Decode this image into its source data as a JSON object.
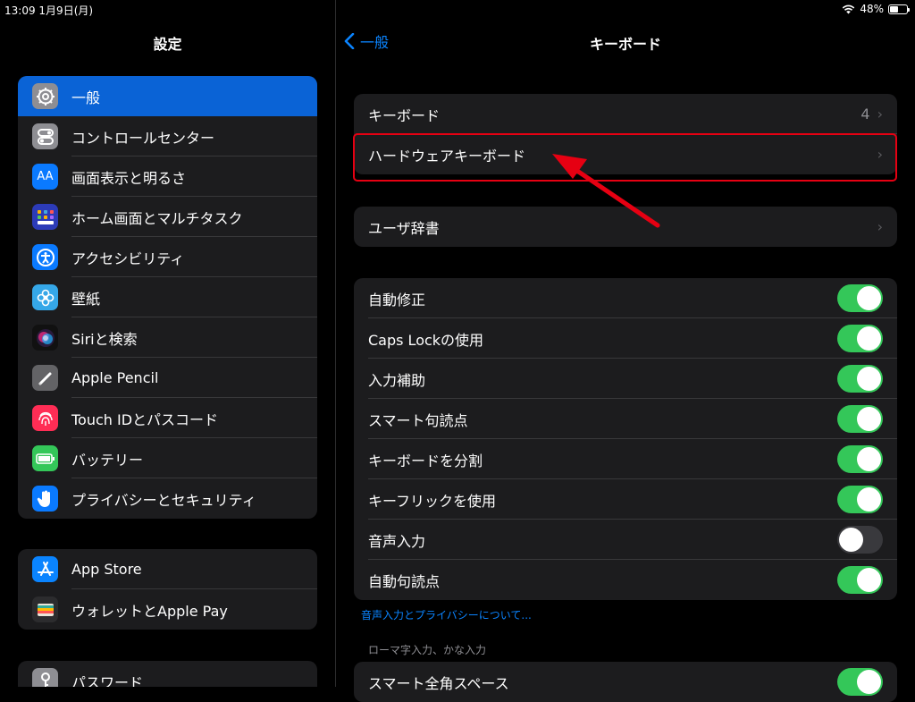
{
  "status_bar": {
    "time": "13:09",
    "date": "1月9日(月)",
    "battery": "48%",
    "battery_level": 0.48
  },
  "sidebar": {
    "title": "設定",
    "groups": [
      {
        "items": [
          {
            "label": "一般",
            "icon": "gear-icon",
            "color": "#8e8e93",
            "selected": true
          },
          {
            "label": "コントロールセンター",
            "icon": "toggles-icon",
            "color": "#8e8e93"
          },
          {
            "label": "画面表示と明るさ",
            "icon": "text-size-icon",
            "color": "#0a7aff",
            "icon_text": "AA"
          },
          {
            "label": "ホーム画面とマルチタスク",
            "icon": "home-grid-icon",
            "color": "#2c3bb8"
          },
          {
            "label": "アクセシビリティ",
            "icon": "accessibility-icon",
            "color": "#0a7aff"
          },
          {
            "label": "壁紙",
            "icon": "flower-icon",
            "color": "#35a7e8"
          },
          {
            "label": "Siriと検索",
            "icon": "siri-icon",
            "color": "#111"
          },
          {
            "label": "Apple Pencil",
            "icon": "pencil-icon",
            "color": "#636366"
          },
          {
            "label": "Touch IDとパスコード",
            "icon": "fingerprint-icon",
            "color": "#ff2d55"
          },
          {
            "label": "バッテリー",
            "icon": "battery-icon",
            "color": "#34c759"
          },
          {
            "label": "プライバシーとセキュリティ",
            "icon": "hand-icon",
            "color": "#0a7aff"
          }
        ]
      },
      {
        "items": [
          {
            "label": "App Store",
            "icon": "app-store-icon",
            "color": "#0a84ff"
          },
          {
            "label": "ウォレットとApple Pay",
            "icon": "wallet-icon",
            "color": "#2c2c2e"
          }
        ]
      },
      {
        "items": [
          {
            "label": "パスワード",
            "icon": "key-icon",
            "color": "#8e8e93"
          }
        ]
      }
    ]
  },
  "nav": {
    "back_label": "一般",
    "title": "キーボード"
  },
  "keyboard_rows": {
    "label": "キーボード",
    "value": "4"
  },
  "hardware_row": {
    "label": "ハードウェアキーボード"
  },
  "dictionary_row": {
    "label": "ユーザ辞書"
  },
  "toggles": [
    {
      "label": "自動修正",
      "on": true
    },
    {
      "label": "Caps Lockの使用",
      "on": true
    },
    {
      "label": "入力補助",
      "on": true
    },
    {
      "label": "スマート句読点",
      "on": true
    },
    {
      "label": "キーボードを分割",
      "on": true
    },
    {
      "label": "キーフリックを使用",
      "on": true
    },
    {
      "label": "音声入力",
      "on": false
    },
    {
      "label": "自動句読点",
      "on": true
    }
  ],
  "privacy_link": "音声入力とプライバシーについて...",
  "romaji_section": {
    "header": "ローマ字入力、かな入力",
    "items": [
      {
        "label": "スマート全角スペース",
        "on": true
      }
    ]
  },
  "colors": {
    "accent": "#0a84ff",
    "toggle_on": "#34c759",
    "highlight": "#e60012",
    "selected": "#0a63d6"
  }
}
